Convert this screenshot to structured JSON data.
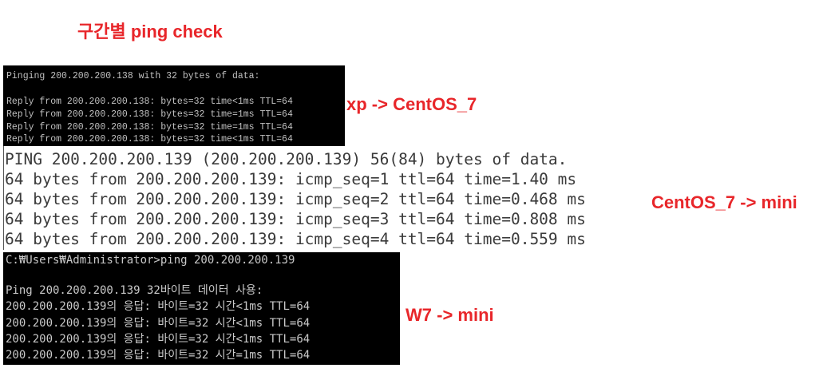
{
  "title": "구간별 ping check",
  "labels": {
    "xp_centos": "xp -> CentOS_7",
    "centos_mini": "CentOS_7 -> mini",
    "w7_mini": "W7 -> mini"
  },
  "xp_console": {
    "header": "Pinging 200.200.200.138 with 32 bytes of data:",
    "replies": [
      "Reply from 200.200.200.138: bytes=32 time<1ms TTL=64",
      "Reply from 200.200.200.138: bytes=32 time=1ms TTL=64",
      "Reply from 200.200.200.138: bytes=32 time=1ms TTL=64",
      "Reply from 200.200.200.138: bytes=32 time<1ms TTL=64"
    ]
  },
  "centos_terminal": {
    "header": "PING 200.200.200.139 (200.200.200.139) 56(84) bytes of data.",
    "replies": [
      "64 bytes from 200.200.200.139: icmp_seq=1 ttl=64 time=1.40 ms",
      "64 bytes from 200.200.200.139: icmp_seq=2 ttl=64 time=0.468 ms",
      "64 bytes from 200.200.200.139: icmp_seq=3 ttl=64 time=0.808 ms",
      "64 bytes from 200.200.200.139: icmp_seq=4 ttl=64 time=0.559 ms"
    ]
  },
  "w7_console": {
    "command": "C:₩Users₩Administrator>ping 200.200.200.139",
    "header": "Ping 200.200.200.139 32바이트 데이터 사용:",
    "replies": [
      "200.200.200.139의 응답: 바이트=32 시간<1ms TTL=64",
      "200.200.200.139의 응답: 바이트=32 시간<1ms TTL=64",
      "200.200.200.139의 응답: 바이트=32 시간<1ms TTL=64",
      "200.200.200.139의 응답: 바이트=32 시간=1ms TTL=64"
    ]
  },
  "colors": {
    "accent_red": "#e8262a",
    "console_bg": "#000000",
    "console_text": "#c0c0c0",
    "terminal_text": "#3a3a3a"
  }
}
